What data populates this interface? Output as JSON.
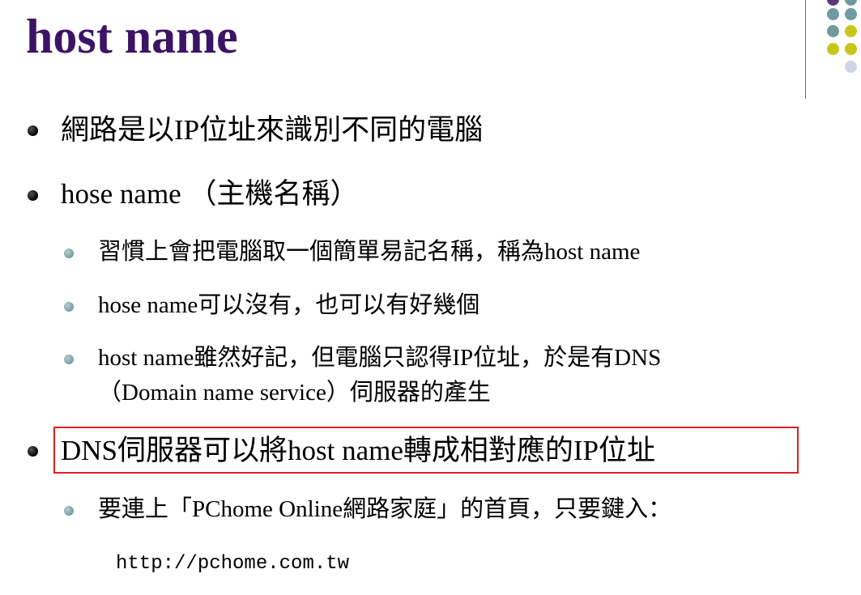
{
  "slide": {
    "title": "host name",
    "colors": {
      "title": "#3b1466",
      "highlight_border": "#e02020",
      "decor_purple": "#5a3a78",
      "decor_teal": "#6f9aa0",
      "decor_yellow": "#c9c61a",
      "decor_lavender": "#d2d2ea"
    },
    "bullets": [
      {
        "text": "網路是以IP位址來識別不同的電腦"
      },
      {
        "text": "hose name （主機名稱）"
      },
      {
        "text": "習慣上會把電腦取一個簡單易記名稱，稱為host name"
      },
      {
        "text": "hose name可以沒有，也可以有好幾個"
      },
      {
        "text": "host name雖然好記，但電腦只認得IP位址，於是有DNS"
      },
      {
        "text": "（Domain name service）伺服器的產生"
      },
      {
        "text": "DNS伺服器可以將host name轉成相對應的IP位址"
      },
      {
        "text": "要連上「PChome Online網路家庭」的首頁，只要鍵入："
      }
    ],
    "url_example": "http://pchome.com.tw"
  }
}
